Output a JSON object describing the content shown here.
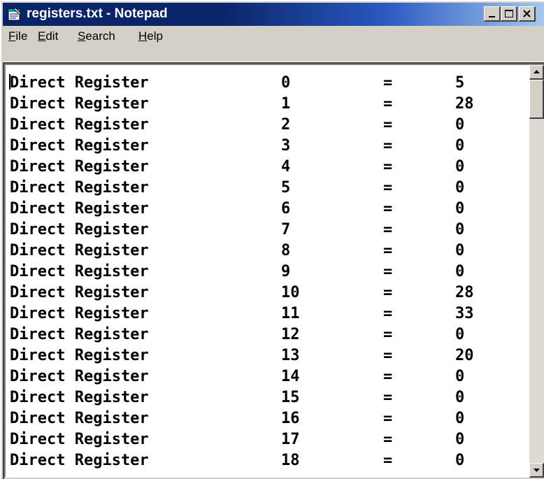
{
  "window": {
    "title": "registers.txt - Notepad",
    "title_icon": "notepad-icon",
    "title_bar_color": "#0a246a",
    "buttons": [
      "minimize-icon",
      "maximize-icon",
      "close-icon"
    ]
  },
  "menu": {
    "items": [
      {
        "accel": "F",
        "rest": "ile"
      },
      {
        "accel": "E",
        "rest": "dit"
      },
      {
        "accel": "S",
        "rest": "earch"
      },
      {
        "accel": "H",
        "rest": "elp"
      }
    ]
  },
  "document": {
    "lines": [
      {
        "name": "Direct Register",
        "index": "0",
        "eq": "=",
        "value": "5"
      },
      {
        "name": "Direct Register",
        "index": "1",
        "eq": "=",
        "value": "28"
      },
      {
        "name": "Direct Register",
        "index": "2",
        "eq": "=",
        "value": "0"
      },
      {
        "name": "Direct Register",
        "index": "3",
        "eq": "=",
        "value": "0"
      },
      {
        "name": "Direct Register",
        "index": "4",
        "eq": "=",
        "value": "0"
      },
      {
        "name": "Direct Register",
        "index": "5",
        "eq": "=",
        "value": "0"
      },
      {
        "name": "Direct Register",
        "index": "6",
        "eq": "=",
        "value": "0"
      },
      {
        "name": "Direct Register",
        "index": "7",
        "eq": "=",
        "value": "0"
      },
      {
        "name": "Direct Register",
        "index": "8",
        "eq": "=",
        "value": "0"
      },
      {
        "name": "Direct Register",
        "index": "9",
        "eq": "=",
        "value": "0"
      },
      {
        "name": "Direct Register",
        "index": "10",
        "eq": "=",
        "value": "28"
      },
      {
        "name": "Direct Register",
        "index": "11",
        "eq": "=",
        "value": "33"
      },
      {
        "name": "Direct Register",
        "index": "12",
        "eq": "=",
        "value": "0"
      },
      {
        "name": "Direct Register",
        "index": "13",
        "eq": "=",
        "value": "20"
      },
      {
        "name": "Direct Register",
        "index": "14",
        "eq": "=",
        "value": "0"
      },
      {
        "name": "Direct Register",
        "index": "15",
        "eq": "=",
        "value": "0"
      },
      {
        "name": "Direct Register",
        "index": "16",
        "eq": "=",
        "value": "0"
      },
      {
        "name": "Direct Register",
        "index": "17",
        "eq": "=",
        "value": "0"
      },
      {
        "name": "Direct Register",
        "index": "18",
        "eq": "=",
        "value": "0"
      }
    ]
  },
  "scrollbar": {
    "position_fraction": 0.0,
    "up_icon": "arrow-up-icon",
    "down_icon": "arrow-down-icon"
  }
}
